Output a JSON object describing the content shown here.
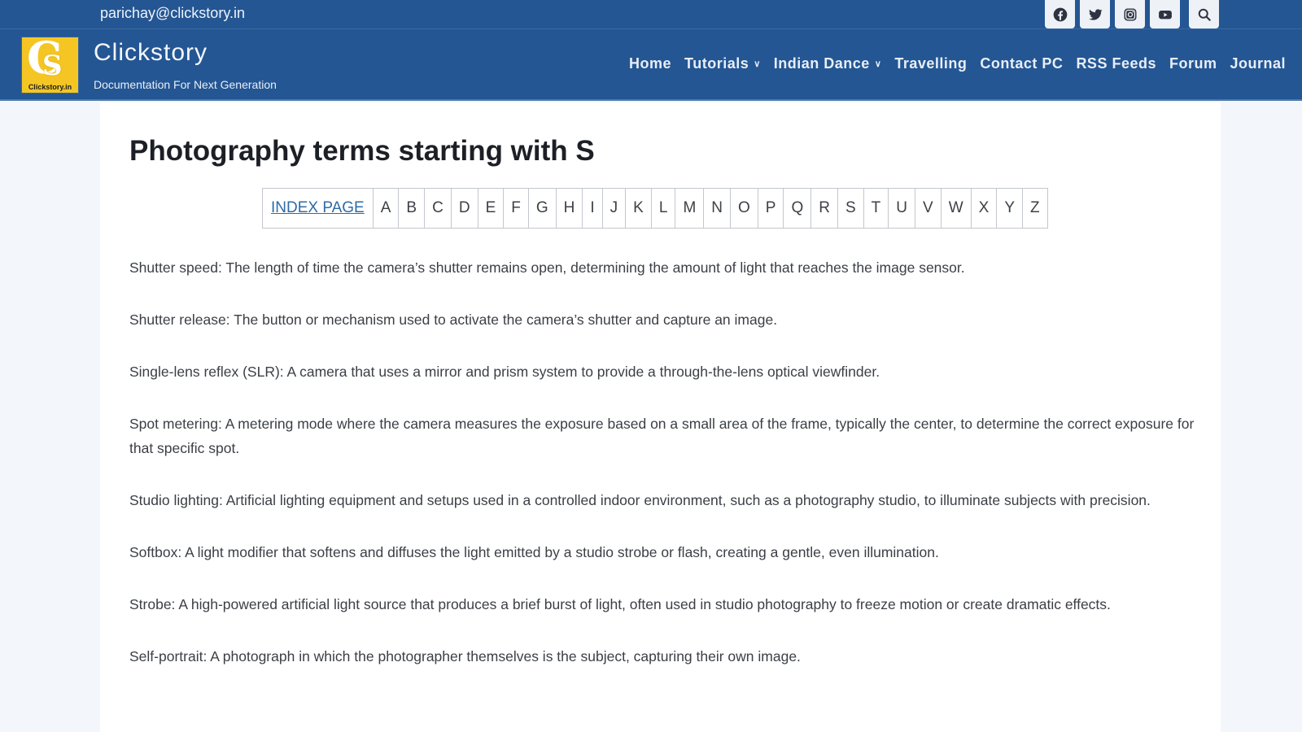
{
  "topbar": {
    "email": "parichay@clickstory.in",
    "social": [
      {
        "name": "facebook-icon"
      },
      {
        "name": "twitter-icon"
      },
      {
        "name": "instagram-icon"
      },
      {
        "name": "youtube-icon"
      },
      {
        "name": "search-icon"
      }
    ]
  },
  "header": {
    "logo_text": "Clickstory.in",
    "logo_letter_big": "C",
    "logo_letter_small": "S",
    "site_title": "Clickstory",
    "site_tagline": "Documentation For Next Generation",
    "nav": [
      {
        "label": "Home",
        "dropdown": false
      },
      {
        "label": "Tutorials",
        "dropdown": true
      },
      {
        "label": "Indian Dance",
        "dropdown": true
      },
      {
        "label": "Travelling",
        "dropdown": false
      },
      {
        "label": "Contact PC",
        "dropdown": false
      },
      {
        "label": "RSS Feeds",
        "dropdown": false
      },
      {
        "label": "Forum",
        "dropdown": false
      },
      {
        "label": "Journal",
        "dropdown": false
      }
    ],
    "chevron": "⌄"
  },
  "main": {
    "title": "Photography terms starting with S",
    "index_link": "INDEX PAGE",
    "letters": [
      "A",
      "B",
      "C",
      "D",
      "E",
      "F",
      "G",
      "H",
      "I",
      "J",
      "K",
      "L",
      "M",
      "N",
      "O",
      "P",
      "Q",
      "R",
      "S",
      "T",
      "U",
      "V",
      "W",
      "X",
      "Y",
      "Z"
    ],
    "terms": [
      "Shutter speed: The length of time the camera’s shutter remains open, determining the amount of light that reaches the image sensor.",
      "Shutter release: The button or mechanism used to activate the camera’s shutter and capture an image.",
      "Single-lens reflex (SLR): A camera that uses a mirror and prism system to provide a through-the-lens optical viewfinder.",
      "Spot metering: A metering mode where the camera measures the exposure based on a small area of the frame, typically the center, to determine the correct exposure for that specific spot.",
      "Studio lighting: Artificial lighting equipment and setups used in a controlled indoor environment, such as a photography studio, to illuminate subjects with precision.",
      "Softbox: A light modifier that softens and diffuses the light emitted by a studio strobe or flash, creating a gentle, even illumination.",
      "Strobe: A high-powered artificial light source that produces a brief burst of light, often used in studio photography to freeze motion or create dramatic effects.",
      "Self-portrait: A photograph in which the photographer themselves is the subject, capturing their own image."
    ]
  },
  "colors": {
    "header_bg": "#245693",
    "logo_bg": "#f5c623",
    "link": "#2e6ba8",
    "page_bg": "#f3f7fb"
  }
}
